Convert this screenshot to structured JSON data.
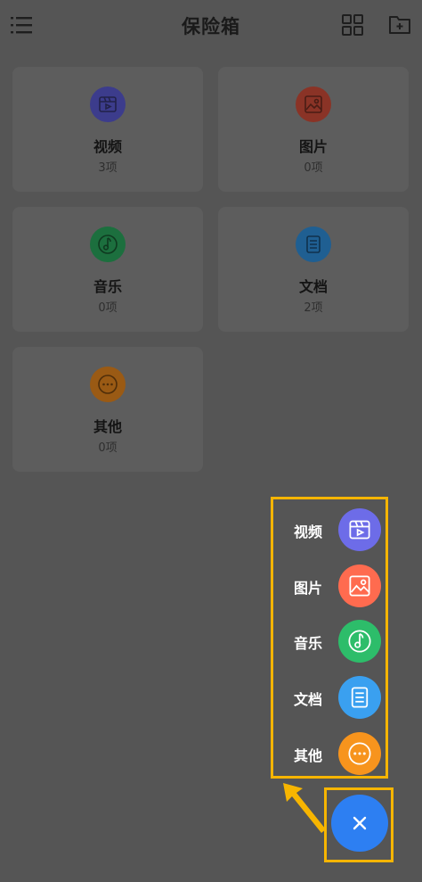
{
  "header": {
    "title": "保险箱",
    "menu_icon": "menu-icon",
    "grid_icon": "grid-view-icon",
    "new_folder_icon": "folder-add-icon"
  },
  "categories": [
    {
      "name": "视频",
      "count": "3项",
      "icon": "video-icon",
      "color": "#3c3c8c"
    },
    {
      "name": "图片",
      "count": "0项",
      "icon": "image-icon",
      "color": "#8a3326"
    },
    {
      "name": "音乐",
      "count": "0项",
      "icon": "music-icon",
      "color": "#1c6f3e"
    },
    {
      "name": "文档",
      "count": "2项",
      "icon": "document-icon",
      "color": "#1f5f92"
    },
    {
      "name": "其他",
      "count": "0项",
      "icon": "more-icon",
      "color": "#9a5a14"
    }
  ],
  "fab_menu": {
    "items": [
      {
        "label": "视频",
        "icon": "video-icon",
        "color": "#6d6ce8"
      },
      {
        "label": "图片",
        "icon": "image-icon",
        "color": "#ff6b4f"
      },
      {
        "label": "音乐",
        "icon": "music-icon",
        "color": "#2dbd6a"
      },
      {
        "label": "文档",
        "icon": "document-icon",
        "color": "#3aa0f0"
      },
      {
        "label": "其他",
        "icon": "more-icon",
        "color": "#f7941d"
      }
    ],
    "close_icon": "close-icon",
    "close_color": "#2d7ff2",
    "highlight_color": "#f7b500"
  }
}
